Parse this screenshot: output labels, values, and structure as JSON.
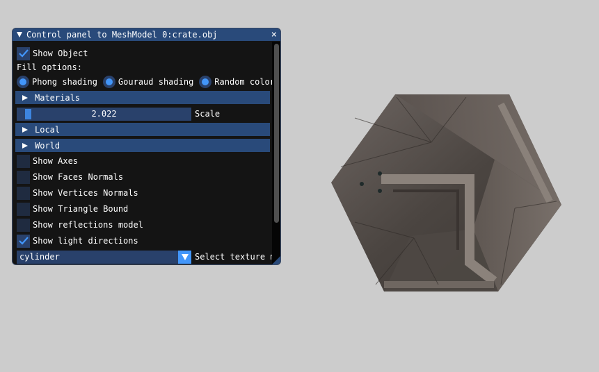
{
  "window": {
    "title": "Control panel to MeshModel 0:crate.obj",
    "close_glyph": "×"
  },
  "panel": {
    "show_object": {
      "label": "Show Object",
      "checked": true
    },
    "fill_options_label": "Fill options:",
    "shading_options": [
      {
        "label": "Phong shading"
      },
      {
        "label": "Gouraud shading"
      },
      {
        "label": "Random color"
      }
    ],
    "headers": {
      "materials": "Materials",
      "local": "Local",
      "world": "World"
    },
    "scale": {
      "value": "2.022",
      "label": "Scale"
    },
    "toggles": [
      {
        "label": "Show Axes",
        "checked": false
      },
      {
        "label": "Show Faces Normals",
        "checked": false
      },
      {
        "label": "Show Vertices Normals",
        "checked": false
      },
      {
        "label": "Show Triangle Bound",
        "checked": false
      },
      {
        "label": "Show reflections model",
        "checked": false
      },
      {
        "label": "Show light directions",
        "checked": true
      }
    ],
    "texture_combo": {
      "value": "cylinder",
      "label": "Select texture m"
    }
  },
  "colors": {
    "accent": "#4296fa",
    "header_bg": "#294a7a",
    "frame_bg": "#29416b",
    "window_bg": "#141414",
    "canvas_bg": "#cccccc"
  },
  "icons": {
    "collapse": "triangle-down-icon",
    "expand": "triangle-right-icon",
    "check": "checkmark-icon",
    "dropdown": "triangle-down-icon"
  }
}
